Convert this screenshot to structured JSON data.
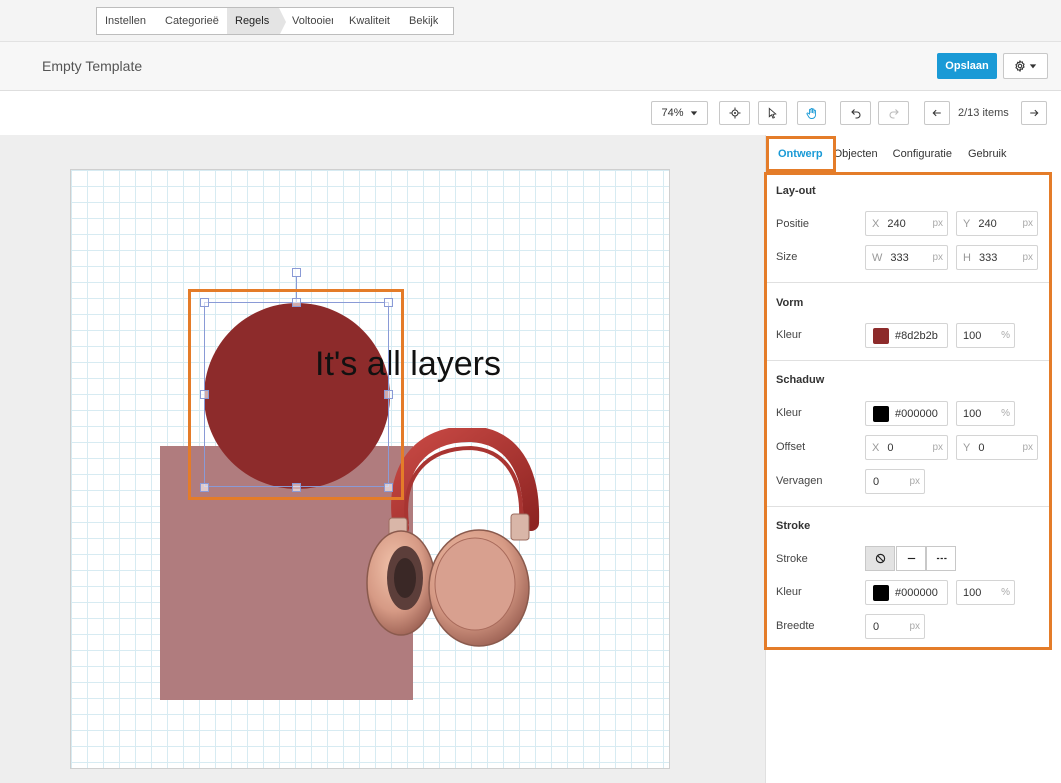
{
  "steps": [
    {
      "label": "Instellen",
      "active": false
    },
    {
      "label": "Categorieën",
      "active": false
    },
    {
      "label": "Regels",
      "active": true
    },
    {
      "label": "Voltooien",
      "active": false
    },
    {
      "label": "Kwaliteit",
      "active": false
    },
    {
      "label": "Bekijk",
      "active": false
    }
  ],
  "header": {
    "title": "Empty Template",
    "save_label": "Opslaan",
    "settings_icon": "gear-icon"
  },
  "toolbar": {
    "zoom": "74%",
    "items_label": "2/13 items"
  },
  "canvas": {
    "text": "It's all layers",
    "circle_color": "#8d2b2b",
    "rect_color": "#b07c7e",
    "image_alt": "headphones-image"
  },
  "tabs": [
    {
      "label": "Ontwerp",
      "active": true
    },
    {
      "label": "Objecten",
      "active": false
    },
    {
      "label": "Configuratie",
      "active": false
    },
    {
      "label": "Gebruik",
      "active": false
    }
  ],
  "props": {
    "layout": {
      "title": "Lay-out",
      "position_label": "Positie",
      "x_prefix": "X",
      "x_value": "240",
      "y_prefix": "Y",
      "y_value": "240",
      "size_label": "Size",
      "w_prefix": "W",
      "w_value": "333",
      "h_prefix": "H",
      "h_value": "333",
      "unit": "px"
    },
    "vorm": {
      "title": "Vorm",
      "color_label": "Kleur",
      "color": "#8d2b2b",
      "color_text": "#8d2b2b",
      "opacity": "100",
      "percent": "%"
    },
    "schaduw": {
      "title": "Schaduw",
      "color_label": "Kleur",
      "color": "#000000",
      "color_text": "#000000",
      "opacity": "100",
      "percent": "%",
      "offset_label": "Offset",
      "x_prefix": "X",
      "x_value": "0",
      "y_prefix": "Y",
      "y_value": "0",
      "blur_label": "Vervagen",
      "blur_value": "0",
      "unit": "px"
    },
    "stroke": {
      "title": "Stroke",
      "stroke_label": "Stroke",
      "color_label": "Kleur",
      "color": "#000000",
      "color_text": "#000000",
      "opacity": "100",
      "percent": "%",
      "width_label": "Breedte",
      "width_value": "0",
      "unit": "px"
    }
  },
  "colors": {
    "accent": "#1a9ad6",
    "highlight": "#e47c29"
  }
}
